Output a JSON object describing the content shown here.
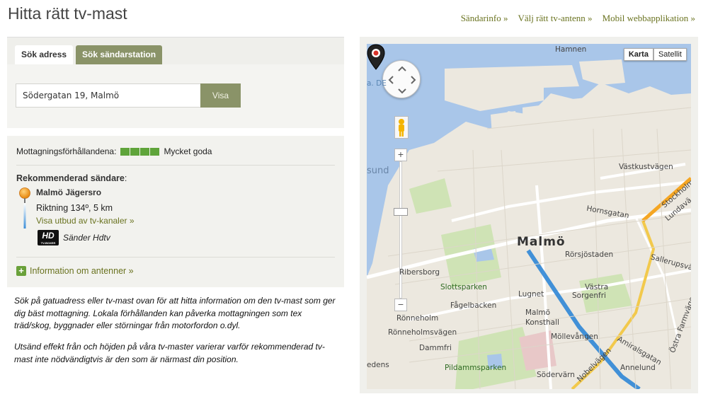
{
  "page": {
    "title": "Hitta rätt tv-mast"
  },
  "nav": {
    "items": [
      {
        "label": "Sändarinfo »"
      },
      {
        "label": "Välj rätt tv-antenn »"
      },
      {
        "label": "Mobil webbapplikation »"
      }
    ]
  },
  "search": {
    "tabs": [
      {
        "label": "Sök adress",
        "active": true
      },
      {
        "label": "Sök sändarstation",
        "active": false
      }
    ],
    "address_value": "Södergatan 19, Malmö",
    "button_label": "Visa"
  },
  "reception": {
    "label": "Mottagningsförhållandena:",
    "level": "Mycket goda",
    "bars": 4
  },
  "recommended": {
    "label": "Rekommenderad sändare",
    "colon": ":",
    "station": "Malmö Jägersro",
    "direction": "Riktning 134º, 5 km",
    "channels_link": "Visa utbud av tv-kanaler »",
    "hd_badge": "HD",
    "hd_badge_sub": "TV-BOXER",
    "hd_label": "Sänder Hdtv"
  },
  "antenna_info": {
    "label": "Information om antenner »"
  },
  "description": {
    "p1": "Sök på gatuadress eller tv-mast ovan för att hitta information om den tv-mast som ger dig bäst mottagning. Lokala förhållanden kan påverka mottagningen som tex träd/skog, byggnader eller störningar från motorfordon o.dyl.",
    "p2": "Utsänd effekt från och höjden på våra tv-master varierar varför rekommenderad tv-mast inte nödvändigtvis är den som är närmast din position."
  },
  "map": {
    "type_buttons": [
      {
        "label": "Karta",
        "selected": true
      },
      {
        "label": "Satellit",
        "selected": false
      }
    ],
    "zoom_in": "+",
    "zoom_out": "−",
    "labels": {
      "hamnen": "Hamnen",
      "de": "a. DE",
      "sund": "sund",
      "malmo": "Malmö",
      "vastkustvagen": "Västkustvägen",
      "stockholmsvagen": "Stockholm",
      "lundavagen": "Lundavä",
      "hornsgatan": "Hornsgatan",
      "rorsjostaden": "Rörsjöstaden",
      "sallerupsvagen": "Sallerupsväg",
      "ribersborg": "Ribersborg",
      "slottsparken": "Slottsparken",
      "lugnet": "Lugnet",
      "vastra": "Västra",
      "sorgenfri": "Sorgenfri",
      "fagelbacken": "Fågelbacken",
      "ronneholm": "Rönneholm",
      "malmo_konsthall_1": "Malmö",
      "malmo_konsthall_2": "Konsthall",
      "ostra_farmvagen": "Östra Farmvägen",
      "ronnehomsvagen": "Rönneholmsvägen",
      "mollevangen": "Möllevången",
      "dammfri": "Dammfri",
      "amiralsgatan": "Amiralsgatan",
      "pildammsparken": "Pildammsparken",
      "nobelvagen": "Nobelvägen",
      "annelund": "Annelund",
      "sodervarn": "Södervärn",
      "hedens": "edens"
    }
  }
}
